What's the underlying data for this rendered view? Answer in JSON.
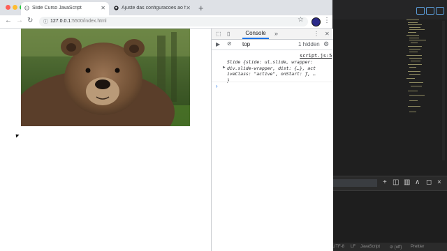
{
  "browser": {
    "tabs": [
      {
        "label": "Slide Curso JavaScript",
        "active": true
      },
      {
        "label": "Ajuste das configuracoes ao fa",
        "active": false
      }
    ],
    "new_tab_label": "+",
    "address": {
      "host": "127.0.0.1",
      "rest": ":5500/index.html"
    }
  },
  "page": {
    "image_alt": "bear"
  },
  "devtools": {
    "tabs": [
      "Console"
    ],
    "more_label": "»",
    "context": "top",
    "hidden_count": "1 hidden",
    "source_link": "script.js:5",
    "log_lines": [
      "Slide {slide: ul.slide, wrapper:",
      "div.slide-wrapper, dist: {…}, act",
      "iveClass: \"active\", onStart: ƒ, …",
      "}"
    ],
    "prompt": "›"
  },
  "editor": {
    "status": [
      "UTF-8",
      "LF",
      "JavaScript",
      "⊘ {off}",
      "Prettier"
    ]
  },
  "colors": {
    "accent": "#1a73e8",
    "traffic_red": "#fe5f57",
    "traffic_yellow": "#febc2e",
    "traffic_green": "#28c840"
  }
}
